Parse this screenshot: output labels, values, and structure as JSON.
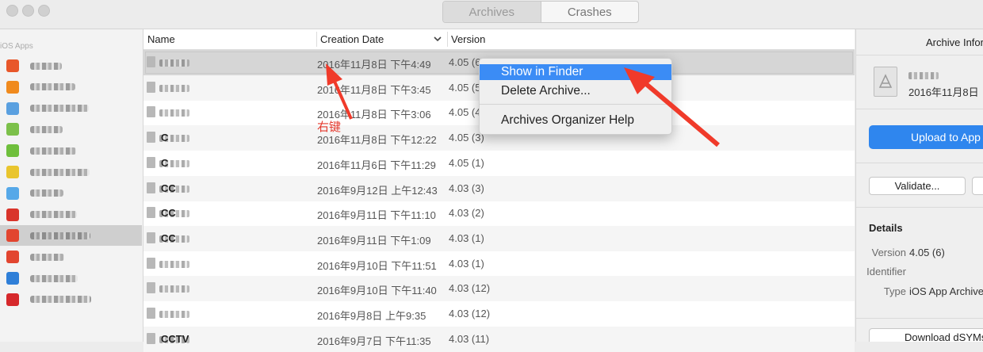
{
  "window": {
    "segments": [
      {
        "label": "Archives",
        "active": true
      },
      {
        "label": "Crashes",
        "active": false
      }
    ]
  },
  "sidebar": {
    "header": "iOS Apps",
    "items": [
      {
        "icon": "app-icon",
        "color": "#e8572a",
        "selected": false
      },
      {
        "icon": "app-icon",
        "color": "#f08a1d",
        "selected": false
      },
      {
        "icon": "app-icon",
        "color": "#5aa0e0",
        "selected": false
      },
      {
        "icon": "app-icon",
        "color": "#7cc04a",
        "selected": false
      },
      {
        "icon": "app-icon",
        "color": "#6fbf3c",
        "selected": false
      },
      {
        "icon": "app-icon",
        "color": "#e9c52e",
        "selected": false
      },
      {
        "icon": "app-icon",
        "color": "#56a8e8",
        "selected": false
      },
      {
        "icon": "app-icon",
        "color": "#d9342b",
        "selected": false
      },
      {
        "icon": "app-icon",
        "color": "#e2452f",
        "selected": true
      },
      {
        "icon": "app-icon",
        "color": "#e2452f",
        "selected": false
      },
      {
        "icon": "app-icon",
        "color": "#2f7fd8",
        "selected": false
      },
      {
        "icon": "app-icon",
        "color": "#d6282b",
        "selected": false
      }
    ]
  },
  "table": {
    "columns": {
      "name": "Name",
      "creation_date": "Creation Date",
      "version": "Version"
    },
    "rows": [
      {
        "name": "",
        "date": "2016年11月8日 下午4:49",
        "version": "4.05 (6)",
        "selected": true
      },
      {
        "name": "",
        "date": "2016年11月8日 下午3:45",
        "version": "4.05 (5)"
      },
      {
        "name": "",
        "date": "2016年11月8日 下午3:06",
        "version": "4.05 (4)"
      },
      {
        "name": "C",
        "date": "2016年11月8日 下午12:22",
        "version": "4.05 (3)"
      },
      {
        "name": "C",
        "date": "2016年11月6日 下午11:29",
        "version": "4.05 (1)"
      },
      {
        "name": "CC",
        "date": "2016年9月12日 上午12:43",
        "version": "4.03 (3)"
      },
      {
        "name": "CC",
        "date": "2016年9月11日 下午11:10",
        "version": "4.03 (2)"
      },
      {
        "name": "CC",
        "date": "2016年9月11日 下午1:09",
        "version": "4.03 (1)"
      },
      {
        "name": "",
        "date": "2016年9月10日 下午11:51",
        "version": "4.03 (1)"
      },
      {
        "name": "",
        "date": "2016年9月10日 下午11:40",
        "version": "4.03 (12)"
      },
      {
        "name": "",
        "date": "2016年9月8日 上午9:35",
        "version": "4.03 (12)"
      },
      {
        "name": "CCTV",
        "date": "2016年9月7日 下午11:35",
        "version": "4.03 (11)"
      }
    ]
  },
  "context_menu": {
    "items": [
      "Show in Finder",
      "Delete Archive...",
      "Archives Organizer Help"
    ]
  },
  "annotation": {
    "text": "右键",
    "color": "#e53a2e"
  },
  "right_pane": {
    "title": "Archive Information",
    "archive_date": "2016年11月8日",
    "upload_label": "Upload to App Store...",
    "validate_label": "Validate...",
    "details_header": "Details",
    "details": [
      {
        "key": "Version",
        "value": "4.05 (6)"
      },
      {
        "key": "Identifier",
        "value": ""
      },
      {
        "key": "Type",
        "value": "iOS App Archive"
      }
    ],
    "download_label": "Download dSYMs..."
  },
  "colors": {
    "accent": "#3b8cf5",
    "button_primary": "#2f86ee",
    "arrow": "#f03a2a"
  }
}
